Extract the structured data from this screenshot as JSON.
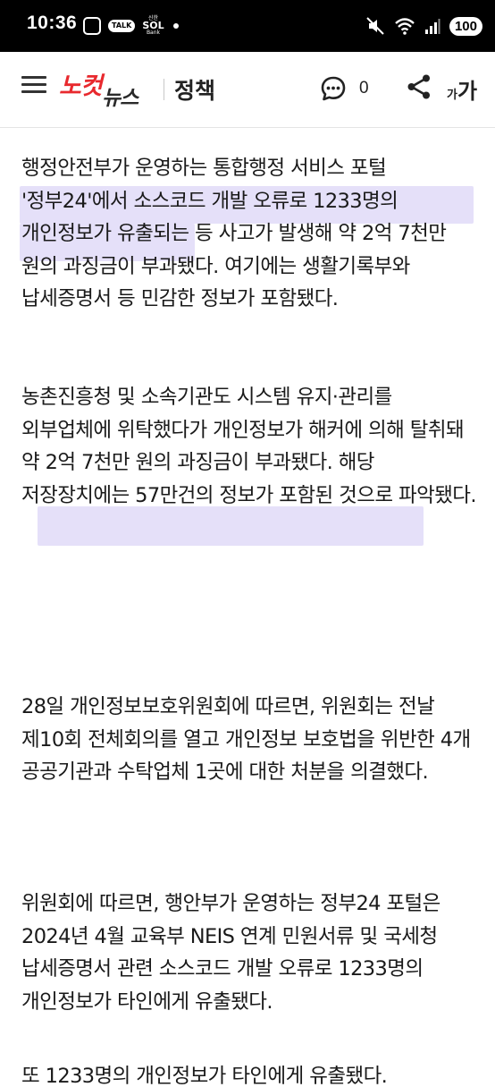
{
  "status_bar": {
    "time": "10:36",
    "talk_label": "TALK",
    "sol_top": "신한",
    "sol_main": "SOL",
    "sol_bottom": "Bank",
    "battery": "100"
  },
  "header": {
    "logo_part1": "노컷",
    "logo_part2": "뉴스",
    "section": "정책",
    "comment_count": "0",
    "font_small": "가",
    "font_big": "가"
  },
  "article": {
    "paragraphs": [
      "행정안전부가 운영하는 통합행정 서비스 포털 '정부24'에서 소스코드 개발 오류로 1233명의 개인정보가 유출되는 등 사고가 발생해 약 2억 7천만 원의 과징금이 부과됐다. 여기에는 생활기록부와 납세증명서 등 민감한 정보가 포함됐다.",
      "농촌진흥청 및 소속기관도 시스템 유지·관리를 외부업체에 위탁했다가 개인정보가 해커에 의해 탈취돼 약 2억 7천만 원의 과징금이 부과됐다. 해당 저장장치에는 57만건의 정보가 포함된 것으로 파악됐다.",
      "28일 개인정보보호위원회에 따르면, 위원회는 전날 제10회 전체회의를 열고 개인정보 보호법을 위반한 4개 공공기관과 수탁업체 1곳에 대한 처분을 의결했다.",
      "위원회에 따르면, 행안부가 운영하는 정부24 포털은 2024년 4월 교육부 NEIS 연계 민원서류 및 국세청 납세증명서 관련 소스코드 개발 오류로 1233명의 개인정보가 타인에게 유출됐다."
    ],
    "cut_line": "또 1233명의 개인정보가 타인에게 유출됐다."
  }
}
